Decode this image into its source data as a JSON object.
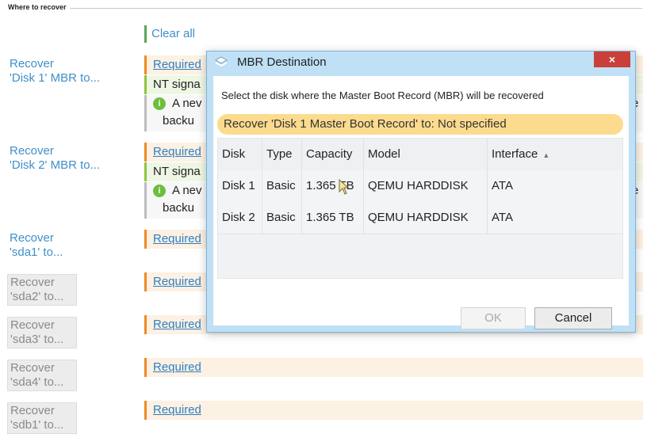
{
  "section": {
    "title": "Where to recover"
  },
  "clear_all": "Clear all",
  "rows": [
    {
      "label_line1": "Recover",
      "label_line2": "'Disk 1' MBR to...",
      "state": "active",
      "required": "Required",
      "sig": "NT signa",
      "note1": "A nev",
      "note2": "backu",
      "note_tail": "e"
    },
    {
      "label_line1": "Recover",
      "label_line2": "'Disk 2' MBR to...",
      "state": "active",
      "required": "Required",
      "sig": "NT signa",
      "note1": "A nev",
      "note2": "backu",
      "note_tail": "e"
    },
    {
      "label_line1": "Recover",
      "label_line2": "'sda1' to...",
      "state": "active",
      "required": "Required"
    },
    {
      "label_line1": "Recover",
      "label_line2": "'sda2' to...",
      "state": "disabled",
      "required": "Required"
    },
    {
      "label_line1": "Recover",
      "label_line2": "'sda3' to...",
      "state": "disabled",
      "required": "Required"
    },
    {
      "label_line1": "Recover",
      "label_line2": "'sda4' to...",
      "state": "disabled",
      "required": "Required"
    },
    {
      "label_line1": "Recover",
      "label_line2": "'sdb1' to...",
      "state": "disabled",
      "required": "Required"
    }
  ],
  "dialog": {
    "title": "MBR Destination",
    "close_glyph": "×",
    "instruction": "Select the disk where the Master Boot Record (MBR) will be recovered",
    "destination": "Recover 'Disk 1 Master Boot Record' to:  Not specified",
    "columns": [
      "Disk",
      "Type",
      "Capacity",
      "Model",
      "Interface"
    ],
    "sort_glyph": "▲",
    "disks": [
      {
        "disk": "Disk 1",
        "type": "Basic",
        "capacity": "1.365 TB",
        "model": "QEMU HARDDISK",
        "interface": "ATA"
      },
      {
        "disk": "Disk 2",
        "type": "Basic",
        "capacity": "1.365 TB",
        "model": "QEMU HARDDISK",
        "interface": "ATA"
      }
    ],
    "ok_label": "OK",
    "cancel_label": "Cancel"
  },
  "colors": {
    "accent_blue": "#3f8fc9",
    "required_orange": "#f08a24",
    "close_red": "#c9403a",
    "banner_yellow": "#fcdb8e"
  },
  "icons": {
    "title_icon": "layers-icon",
    "note_icon": "info-icon",
    "cursor": "mouse-pointer-icon"
  }
}
